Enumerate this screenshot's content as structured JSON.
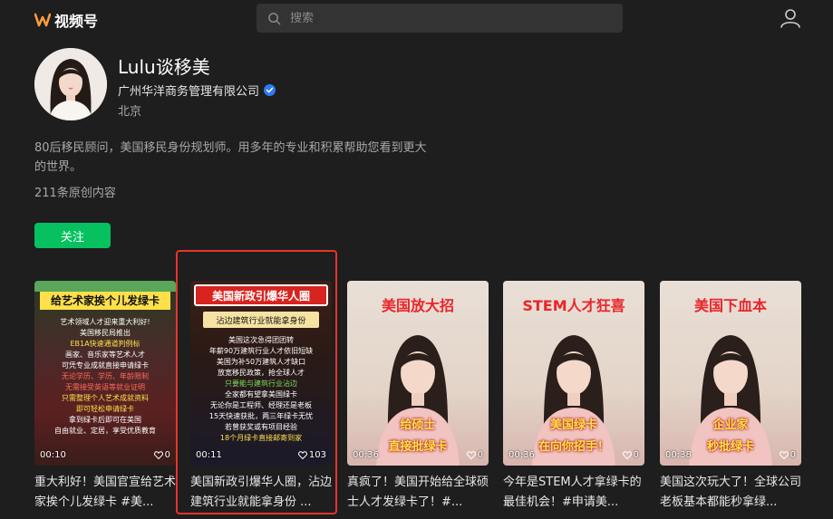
{
  "header": {
    "logo_text": "视频号",
    "search_placeholder": "搜索"
  },
  "profile": {
    "name": "Lulu谈移美",
    "company": "广州华洋商务管理有限公司",
    "location": "北京",
    "bio": "80后移民顾问，美国移民身份规划师。用多年的专业和积累帮助您看到更大的世界。",
    "post_count": "211条原创内容",
    "follow_label": "关注"
  },
  "videos": [
    {
      "title_overlay": "给艺术家挨个儿发绿卡",
      "body_lines": [
        "艺术领域人才迎来重大利好!",
        "美国移民局推出",
        "EB1A快速通道判例标",
        "画家、音乐家等艺术人才",
        "可凭专业成就直接申请绿卡",
        "无论学历、学历、年龄限制",
        "无需接受英语等就业证明",
        "只需整理个人艺术成就资料",
        "即可轻松申请绿卡",
        "拿到绿卡后即可在美国",
        "自由就业、定居，享受优质教育"
      ],
      "duration": "00:10",
      "likes": "0",
      "caption": "重大利好！美国官宣给艺术家挨个儿发绿卡 #美..."
    },
    {
      "title_overlay": "美国新政引爆华人圈",
      "subtitle_overlay": "沾边建筑行业就能拿身份",
      "body_lines": [
        "美国这次急得团团转",
        "年薪90万建筑行业人才依旧短缺",
        "美国为补50万建筑人才缺口",
        "放宽移民政策，抢全球人才",
        "只要能与建筑行业沾边",
        "全家都有望拿美国绿卡",
        "无论你是工程师、经理还是老板",
        "15天快速获批，两三年绿卡无忧",
        "若曾获奖或有项目经验",
        "18个月绿卡直接邮寄到家"
      ],
      "duration": "00:11",
      "likes": "103",
      "caption": "美国新政引爆华人圈，沾边建筑行业就能拿身份 ..."
    },
    {
      "title_overlay": "美国放大招",
      "overlay_line1": "给硕士",
      "overlay_line2": "直接批绿卡",
      "duration": "00:36",
      "likes": "0",
      "caption": "真疯了！美国开始给全球硕士人才发绿卡了！#..."
    },
    {
      "title_overlay": "STEM人才狂喜",
      "overlay_line1": "美国绿卡",
      "overlay_line2": "在向你招手！",
      "duration": "00:36",
      "likes": "0",
      "caption": "今年是STEM人才拿绿卡的最佳机会！#申请美..."
    },
    {
      "title_overlay": "美国下血本",
      "overlay_line1": "企业家",
      "overlay_line2": "秒批绿卡",
      "duration": "00:38",
      "likes": "0",
      "caption": "美国这次玩大了！全球公司老板基本都能秒拿绿..."
    }
  ]
}
